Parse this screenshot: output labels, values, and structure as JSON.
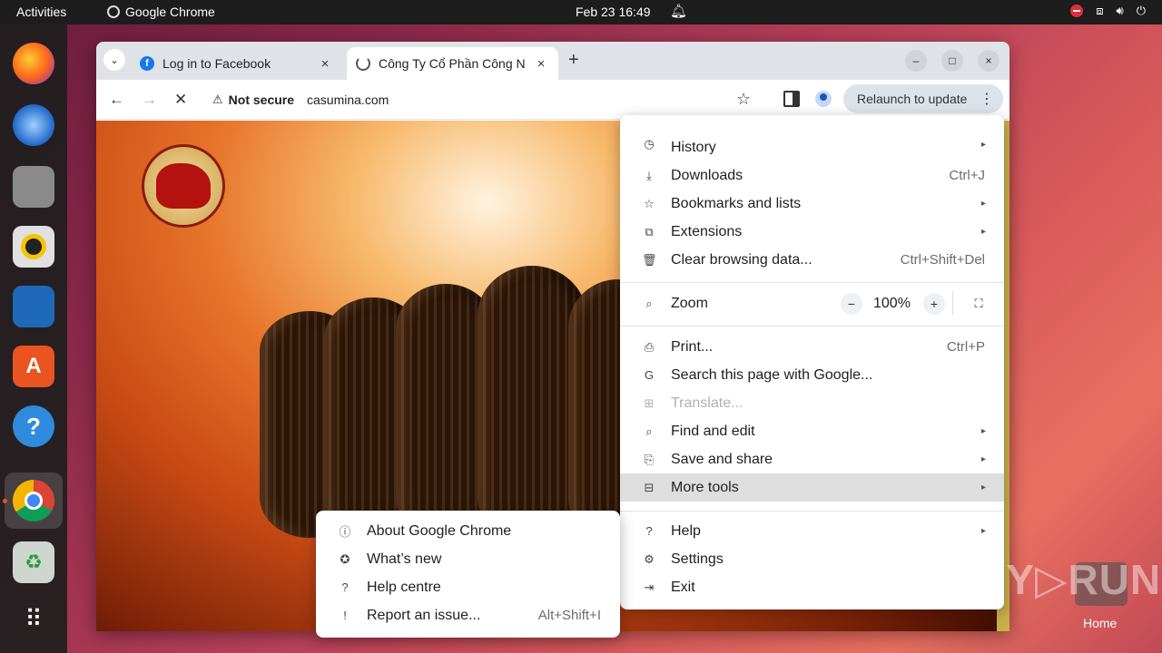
{
  "topbar": {
    "activities": "Activities",
    "app_name": "Google Chrome",
    "clock": "Feb 23  16:49"
  },
  "tabs": [
    {
      "title": "Log in to Facebook",
      "favicon": "facebook-icon",
      "color": "#1877f2"
    },
    {
      "title": "Công Ty Cổ Phần Công N",
      "favicon": "loading-icon",
      "color": "#555555"
    }
  ],
  "toolbar": {
    "security_label": "Not secure",
    "url": "casumina.com",
    "relaunch_label": "Relaunch to update"
  },
  "menu": {
    "history_label": "History",
    "items_top": [
      {
        "icon": "download-icon",
        "glyph": "⤓",
        "label": "Downloads",
        "shortcut": "Ctrl+J"
      },
      {
        "icon": "star-icon",
        "glyph": "☆",
        "label": "Bookmarks and lists",
        "submenu": true
      },
      {
        "icon": "puzzle-icon",
        "glyph": "⧉",
        "label": "Extensions",
        "submenu": true
      },
      {
        "icon": "trash-icon",
        "glyph": "🗑",
        "label": "Clear browsing data...",
        "shortcut": "Ctrl+Shift+Del"
      }
    ],
    "zoom": {
      "label": "Zoom",
      "value": "100%",
      "minus": "−",
      "plus": "+"
    },
    "items_mid": [
      {
        "icon": "printer-icon",
        "glyph": "⎙",
        "label": "Print...",
        "shortcut": "Ctrl+P"
      },
      {
        "icon": "google-icon",
        "glyph": "G",
        "label": "Search this page with Google..."
      },
      {
        "icon": "translate-icon",
        "glyph": "⊞",
        "label": "Translate...",
        "disabled": true
      },
      {
        "icon": "find-icon",
        "glyph": "⌕",
        "label": "Find and edit",
        "submenu": true
      },
      {
        "icon": "save-icon",
        "glyph": "⎘",
        "label": "Save and share",
        "submenu": true
      },
      {
        "icon": "toolbox-icon",
        "glyph": "⊟",
        "label": "More tools",
        "submenu": true,
        "highlighted": true
      }
    ],
    "items_bottom": [
      {
        "icon": "help-icon",
        "glyph": "?",
        "label": "Help",
        "submenu": true
      },
      {
        "icon": "gear-icon",
        "glyph": "⚙",
        "label": "Settings"
      },
      {
        "icon": "exit-icon",
        "glyph": "⇥",
        "label": "Exit"
      }
    ]
  },
  "help_submenu": [
    {
      "icon": "info-icon",
      "glyph": "ⓘ",
      "label": "About Google Chrome"
    },
    {
      "icon": "whats-new-icon",
      "glyph": "✪",
      "label": "What’s new"
    },
    {
      "icon": "question-icon",
      "glyph": "?",
      "label": "Help centre"
    },
    {
      "icon": "report-icon",
      "glyph": "!",
      "label": "Report an issue...",
      "shortcut": "Alt+Shift+I"
    }
  ],
  "watermark": "ANY▷RUN",
  "desktop": {
    "home_label": "Home"
  }
}
